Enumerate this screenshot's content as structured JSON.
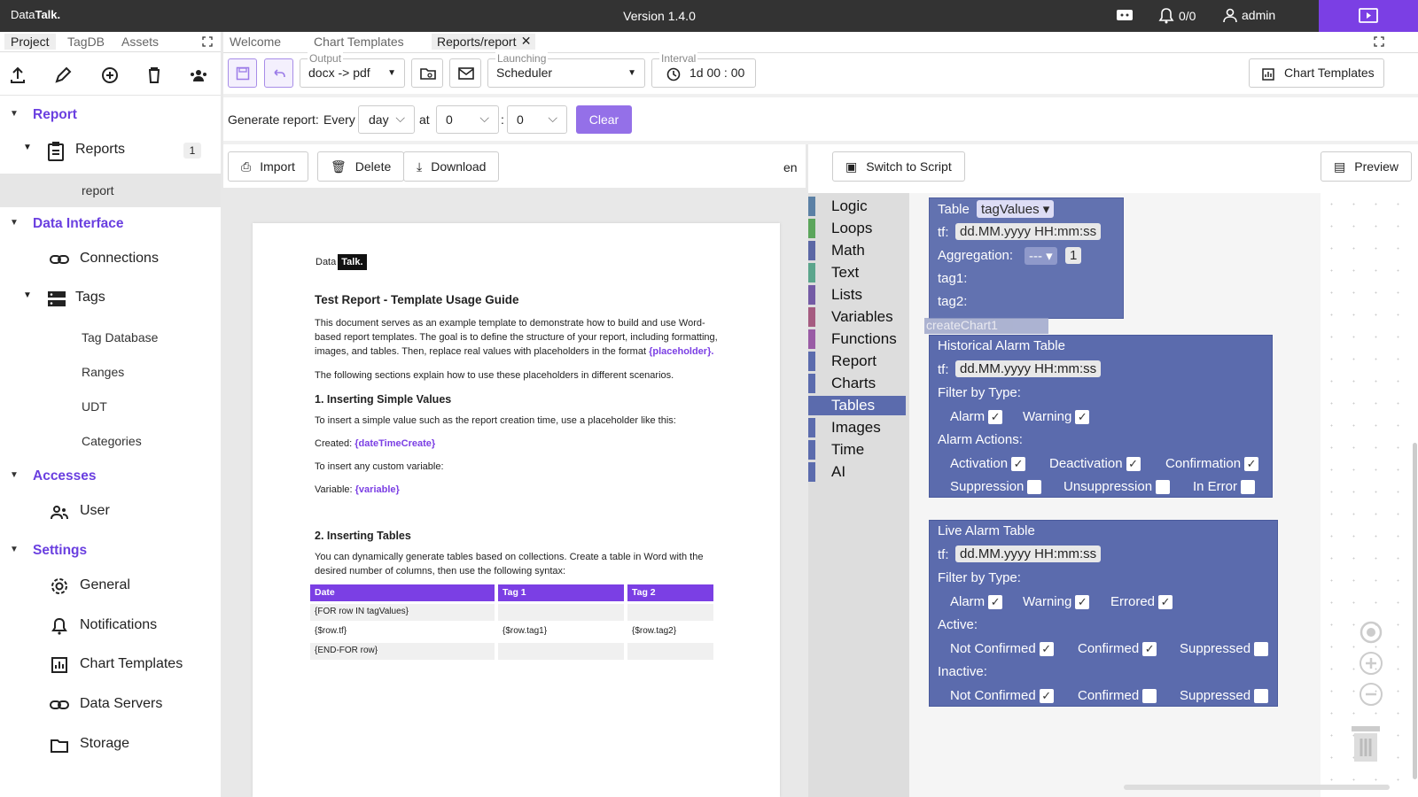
{
  "topbar": {
    "logo_a": "Data",
    "logo_b": "Talk.",
    "version": "Version 1.4.0",
    "alarms": "0/0",
    "user": "admin"
  },
  "left": {
    "tabs": [
      "Project",
      "TagDB",
      "Assets"
    ],
    "sections": [
      {
        "label": "Report"
      },
      {
        "label": "Data Interface"
      },
      {
        "label": "Accesses"
      },
      {
        "label": "Settings"
      }
    ],
    "reports": {
      "label": "Reports",
      "count": "1",
      "child": "report"
    },
    "connections": "Connections",
    "tags": "Tags",
    "tag_children": [
      "Tag Database",
      "Ranges",
      "UDT",
      "Categories"
    ],
    "user": "User",
    "settings": [
      "General",
      "Notifications",
      "Chart Templates",
      "Data Servers",
      "Storage"
    ]
  },
  "maintabs": [
    "Welcome",
    "Chart Templates",
    "Reports/report"
  ],
  "toolbar": {
    "output_label": "Output",
    "output": "docx -> pdf",
    "launching_label": "Launching",
    "launching": "Scheduler",
    "interval_label": "Interval",
    "interval": "1d 00 : 00",
    "chart_templates": "Chart Templates"
  },
  "gen": {
    "label": "Generate report:",
    "every": "Every",
    "period": "day",
    "at": "at",
    "hour": "0",
    "colon": ":",
    "minute": "0",
    "clear": "Clear"
  },
  "docbar": {
    "import": "Import",
    "delete": "Delete",
    "download": "Download",
    "lang": "en"
  },
  "doc": {
    "logo_a": "Data",
    "logo_b": "Talk.",
    "title": "Test Report - Template Usage Guide",
    "p1a": "This document serves as an example template to demonstrate how to build and use Word-",
    "p1b": "based report templates. The goal is to define the structure of your report, including formatting,",
    "p1c": "images, and tables. Then, replace real values with placeholders in the format ",
    "p1ph": "{placeholder}.",
    "p2": "The following sections explain how to use these placeholders in different scenarios.",
    "h1": "1. Inserting Simple Values",
    "p3": "To insert a simple value such as the report creation time, use a placeholder like this:",
    "created": "Created: ",
    "created_ph": "{dateTimeCreate}",
    "p4": "To insert any custom variable:",
    "variable": "Variable: ",
    "variable_ph": "{variable}",
    "h2": "2. Inserting Tables",
    "p5a": "You can dynamically generate tables based on collections. Create a table in Word with the",
    "p5b": "desired number of columns, then use the following syntax:",
    "table_headers": [
      "Date",
      "Tag 1",
      "Tag 2"
    ],
    "table_rows": [
      [
        "{FOR row IN tagValues}",
        "",
        ""
      ],
      [
        "{$row.tf}",
        "{$row.tag1}",
        "{$row.tag2}"
      ],
      [
        "{END-FOR row}",
        "",
        ""
      ]
    ]
  },
  "blockly": {
    "switch": "Switch to Script",
    "preview": "Preview",
    "categories": [
      {
        "label": "Logic",
        "color": "#5b80a5"
      },
      {
        "label": "Loops",
        "color": "#5ba55b"
      },
      {
        "label": "Math",
        "color": "#5b67a5"
      },
      {
        "label": "Text",
        "color": "#5ba58c"
      },
      {
        "label": "Lists",
        "color": "#745ba5"
      },
      {
        "label": "Variables",
        "color": "#a55b80"
      },
      {
        "label": "Functions",
        "color": "#995ba5"
      },
      {
        "label": "Report",
        "color": "#5b6bad"
      },
      {
        "label": "Charts",
        "color": "#5b6bad"
      },
      {
        "label": "Tables",
        "color": "#5b6bad"
      },
      {
        "label": "Images",
        "color": "#5b6bad"
      },
      {
        "label": "Time",
        "color": "#5b6bad"
      },
      {
        "label": "AI",
        "color": "#5b6bad"
      }
    ],
    "table_block": {
      "label": "Table",
      "var": "tagValues",
      "tf": "tf:",
      "tf_val": "dd.MM.yyyy HH:mm:ss",
      "agg": "Aggregation:",
      "agg_val": "---",
      "agg_num": "1",
      "tag1": "tag1:",
      "tag2": "tag2:",
      "ghost": "createChart1"
    },
    "hist": {
      "title": "Historical Alarm Table",
      "tf": "tf:",
      "tf_val": "dd.MM.yyyy HH:mm:ss",
      "filter": "Filter by Type:",
      "alarm": "Alarm",
      "warning": "Warning",
      "actions": "Alarm Actions:",
      "activation": "Activation",
      "deactivation": "Deactivation",
      "confirmation": "Confirmation",
      "suppression": "Suppression",
      "unsuppression": "Unsuppression",
      "inerror": "In Error"
    },
    "live": {
      "title": "Live Alarm Table",
      "tf": "tf:",
      "tf_val": "dd.MM.yyyy HH:mm:ss",
      "filter": "Filter by Type:",
      "alarm": "Alarm",
      "warning": "Warning",
      "errored": "Errored",
      "active": "Active:",
      "notconfirmed": "Not Confirmed",
      "confirmed": "Confirmed",
      "suppressed": "Suppressed",
      "inactive": "Inactive:"
    }
  }
}
